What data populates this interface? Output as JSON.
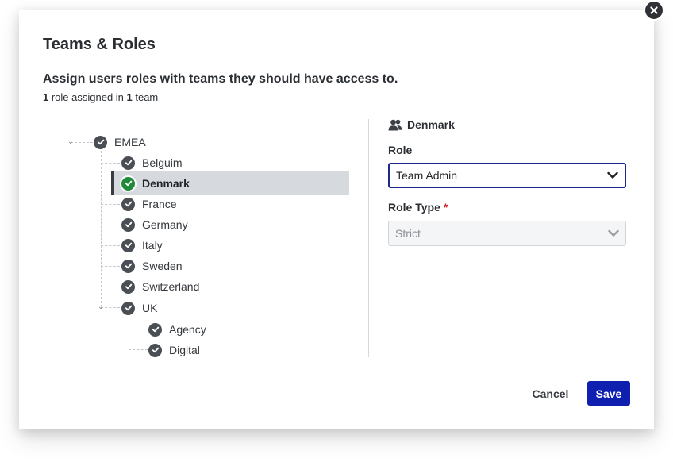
{
  "modal": {
    "title": "Teams & Roles",
    "subtitle": "Assign users roles with teams they should have access to.",
    "summary": {
      "role_count": "1",
      "role_text": " role assigned in ",
      "team_count": "1",
      "team_text": " team"
    }
  },
  "tree": {
    "root": {
      "label": "EMEA",
      "checked": true,
      "expanded": true
    },
    "children": [
      {
        "label": "Belguim",
        "checked": true
      },
      {
        "label": "Denmark",
        "checked": true,
        "selected": true
      },
      {
        "label": "France",
        "checked": true
      },
      {
        "label": "Germany",
        "checked": true
      },
      {
        "label": "Italy",
        "checked": true
      },
      {
        "label": "Sweden",
        "checked": true
      },
      {
        "label": "Switzerland",
        "checked": true
      },
      {
        "label": "UK",
        "checked": true,
        "expanded": true
      }
    ],
    "uk_children": [
      {
        "label": "Agency",
        "checked": true
      },
      {
        "label": "Digital",
        "checked": true
      }
    ]
  },
  "panel": {
    "team_name": "Denmark",
    "role_label": "Role",
    "role_value": "Team Admin",
    "role_type_label": "Role Type",
    "required_marker": "*",
    "role_type_value": "Strict"
  },
  "footer": {
    "cancel_label": "Cancel",
    "save_label": "Save"
  },
  "colors": {
    "primary": "#0f1fb0",
    "success": "#1e8a3a",
    "selected_row": "#d6d9de",
    "required": "#d0242b"
  },
  "icons": {
    "close": "close-icon",
    "check": "check-circle-icon",
    "team": "team-icon",
    "dropdown": "chevron-down-icon",
    "expand": "caret-down-icon"
  }
}
